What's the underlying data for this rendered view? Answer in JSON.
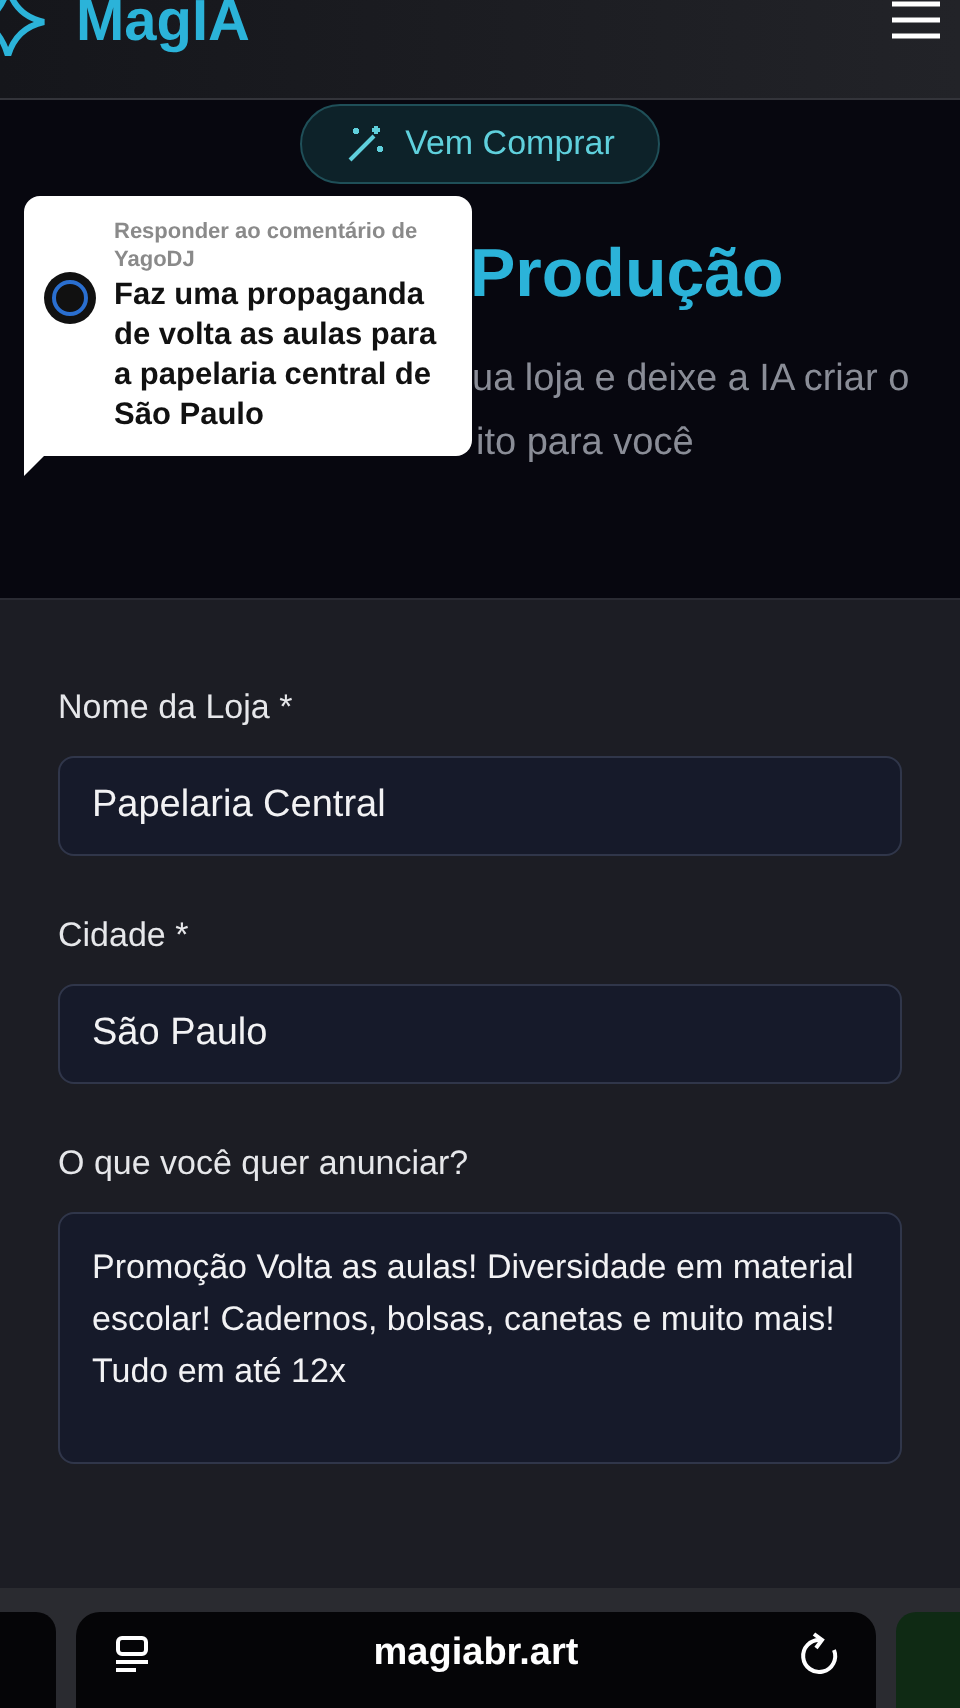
{
  "header": {
    "logo": "MagIA"
  },
  "hero": {
    "cta_button": "Vem Comprar",
    "title": "Produção",
    "subtitle_lines": [
      "ua loja e deixe a IA criar o",
      "ito para você"
    ]
  },
  "comment": {
    "reply_label": "Responder ao comentário de",
    "username": "YagoDJ",
    "text": "Faz uma propaganda de volta as aulas para a papelaria central de São Paulo"
  },
  "form": {
    "fields": [
      {
        "kind": "input",
        "label": "Nome da Loja *",
        "value": "Papelaria Central"
      },
      {
        "kind": "input",
        "label": "Cidade *",
        "value": "São Paulo"
      },
      {
        "kind": "textarea",
        "label": "O que você quer anunciar?",
        "value": "Promoção Volta as aulas! Diversidade em material escolar! Cadernos, bolsas, canetas e muito mais! Tudo em até 12x"
      }
    ]
  },
  "browser_bar": {
    "url": "magiabr.art"
  }
}
